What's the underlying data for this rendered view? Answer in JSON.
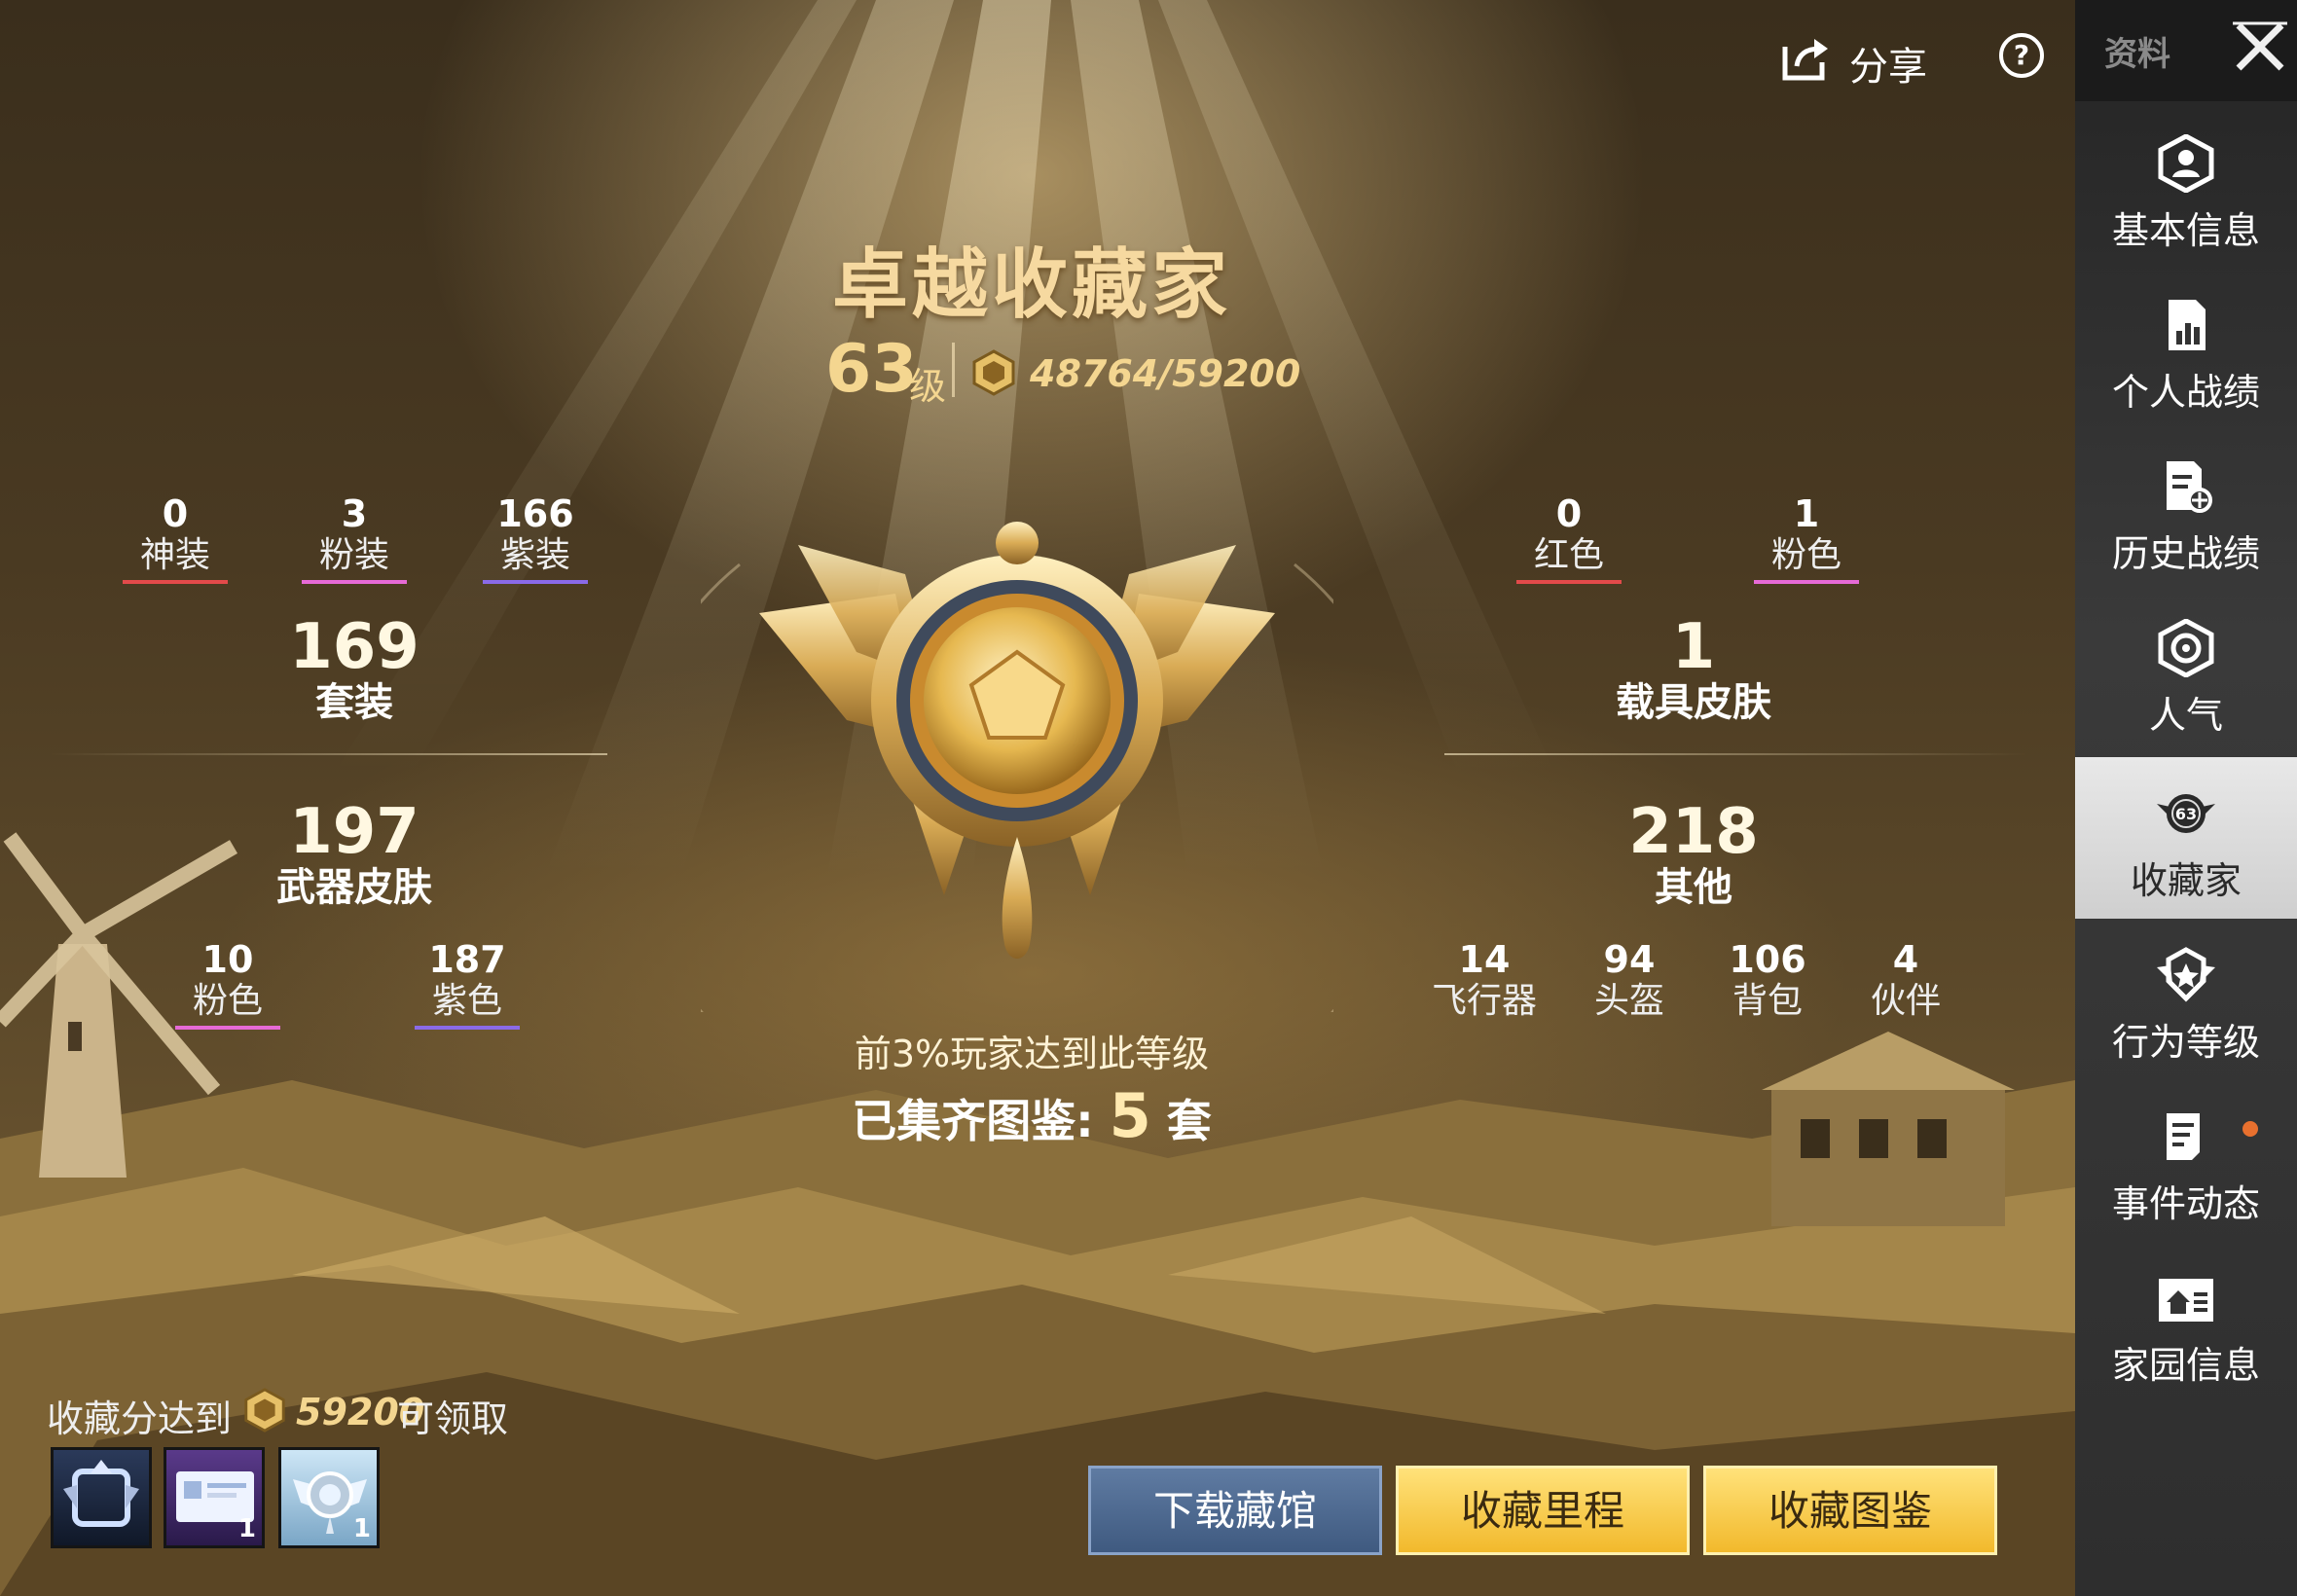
{
  "header": {
    "share_label": "分享",
    "share_icon": "share-icon",
    "help_icon": "help-icon"
  },
  "sidebar": {
    "tab_label": "资料",
    "close_icon": "close-icon",
    "items": [
      {
        "label": "基本信息",
        "icon": "profile-icon",
        "active": false
      },
      {
        "label": "个人战绩",
        "icon": "stats-chart-icon",
        "active": false
      },
      {
        "label": "历史战绩",
        "icon": "history-doc-icon",
        "active": false
      },
      {
        "label": "人气",
        "icon": "popularity-icon",
        "active": false
      },
      {
        "label": "收藏家",
        "icon": "collector-badge-icon",
        "badge": "63",
        "active": true
      },
      {
        "label": "行为等级",
        "icon": "behavior-shield-icon",
        "active": false
      },
      {
        "label": "事件动态",
        "icon": "event-doc-icon",
        "active": false,
        "notification": true
      },
      {
        "label": "家园信息",
        "icon": "home-icon",
        "active": false
      }
    ]
  },
  "collector": {
    "title": "卓越收藏家",
    "level": "63",
    "level_unit": "级",
    "score": "48764/59200",
    "rank_note": "前3%玩家达到此等级",
    "collected_prefix": "已集齐图鉴:",
    "collected_count": "5",
    "collected_suffix": "套"
  },
  "left_stats": {
    "top": [
      {
        "value": "0",
        "label": "神装",
        "color": "#e24a4a"
      },
      {
        "value": "3",
        "label": "粉装",
        "color": "#e66ad6"
      },
      {
        "value": "166",
        "label": "紫装",
        "color": "#8a6ae8"
      }
    ],
    "suits": {
      "value": "169",
      "label": "套装"
    },
    "weapons": {
      "value": "197",
      "label": "武器皮肤"
    },
    "bottom": [
      {
        "value": "10",
        "label": "粉色",
        "color": "#e66ad6"
      },
      {
        "value": "187",
        "label": "紫色",
        "color": "#8a6ae8"
      }
    ]
  },
  "right_stats": {
    "top": [
      {
        "value": "0",
        "label": "红色",
        "color": "#e24a4a"
      },
      {
        "value": "1",
        "label": "粉色",
        "color": "#e66ad6"
      }
    ],
    "vehicles": {
      "value": "1",
      "label": "载具皮肤"
    },
    "others": {
      "value": "218",
      "label": "其他"
    },
    "bottom": [
      {
        "value": "14",
        "label": "飞行器"
      },
      {
        "value": "94",
        "label": "头盔"
      },
      {
        "value": "106",
        "label": "背包"
      },
      {
        "value": "4",
        "label": "伙伴"
      }
    ]
  },
  "rewards": {
    "prefix": "收藏分达到",
    "target": "59200",
    "suffix": "可领取",
    "items": [
      {
        "name": "avatar-frame",
        "count": ""
      },
      {
        "name": "name-card",
        "count": "1"
      },
      {
        "name": "emblem-item",
        "count": "1"
      }
    ]
  },
  "buttons": {
    "download": "下载藏馆",
    "milestones": "收藏里程",
    "catalog": "收藏图鉴"
  },
  "colors": {
    "gold_text": "#f4d690",
    "button_gold": "#f2b92c",
    "button_blue": "#4a6690",
    "active_tab": "#dcdcdc"
  }
}
